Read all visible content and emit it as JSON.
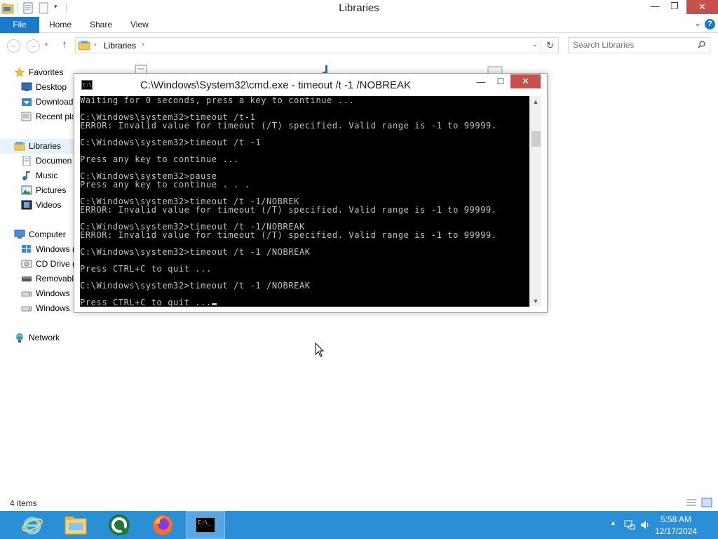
{
  "explorer": {
    "title": "Libraries",
    "controls": {
      "minimize": "—",
      "maximize": "❐",
      "close": "✕"
    },
    "ribbon": {
      "file": "File",
      "tabs": [
        "Home",
        "Share",
        "View"
      ]
    },
    "address": {
      "path": "Libraries",
      "separator": "›"
    },
    "search": {
      "placeholder": "Search Libraries"
    },
    "nav": {
      "favorites": "Favorites",
      "desktop": "Desktop",
      "downloads": "Download",
      "recent": "Recent pla",
      "libraries": "Libraries",
      "documents": "Documen",
      "music": "Music",
      "pictures": "Pictures",
      "videos": "Videos",
      "computer": "Computer",
      "drive_c": "Windows (",
      "cd_drive": "CD Drive (",
      "removable": "Removabl",
      "windows_2": "Windows",
      "windows_3": "Windows",
      "network": "Network"
    },
    "status": {
      "item_count": "4 items"
    }
  },
  "cmd": {
    "title": "C:\\Windows\\System32\\cmd.exe - timeout  /t -1 /NOBREAK",
    "icon_text": "C:\\_",
    "controls": {
      "minimize": "—",
      "maximize": "☐",
      "close": "✕"
    },
    "lines": [
      "Waiting for 0 seconds, press a key to continue ...",
      "",
      "C:\\Windows\\system32>timeout /t-1",
      "ERROR: Invalid value for timeout (/T) specified. Valid range is -1 to 99999.",
      "",
      "C:\\Windows\\system32>timeout /t -1",
      "",
      "Press any key to continue ...",
      "",
      "C:\\Windows\\system32>pause",
      "Press any key to continue . . .",
      "",
      "C:\\Windows\\system32>timeout /t -1/NOBREK",
      "ERROR: Invalid value for timeout (/T) specified. Valid range is -1 to 99999.",
      "",
      "C:\\Windows\\system32>timeout /t -1/NOBREAK",
      "ERROR: Invalid value for timeout (/T) specified. Valid range is -1 to 99999.",
      "",
      "C:\\Windows\\system32>timeout /t -1 /NOBREAK",
      "",
      "Press CTRL+C to quit ...",
      "",
      "C:\\Windows\\system32>timeout /t -1 /NOBREAK",
      "",
      "Press CTRL+C to quit ..."
    ]
  },
  "taskbar": {
    "clock_time": "5:58 AM",
    "clock_date": "12/17/2024"
  }
}
